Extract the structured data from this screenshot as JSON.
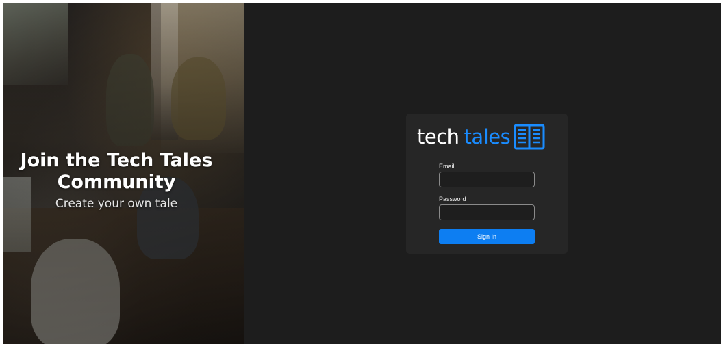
{
  "hero": {
    "title": "Join the Tech Tales Community",
    "subtitle": "Create your own tale",
    "image": "office-coworkers-photo"
  },
  "logo": {
    "part1": "tech",
    "part2": "tales",
    "icon": "open-book-icon",
    "accent_color": "#1a8cff"
  },
  "form": {
    "email_label": "Email",
    "email_value": "",
    "password_label": "Password",
    "password_value": "",
    "signin_label": "Sign In",
    "button_color": "#0d7ef2"
  },
  "colors": {
    "background": "#1d1d1d",
    "card": "#262626"
  }
}
